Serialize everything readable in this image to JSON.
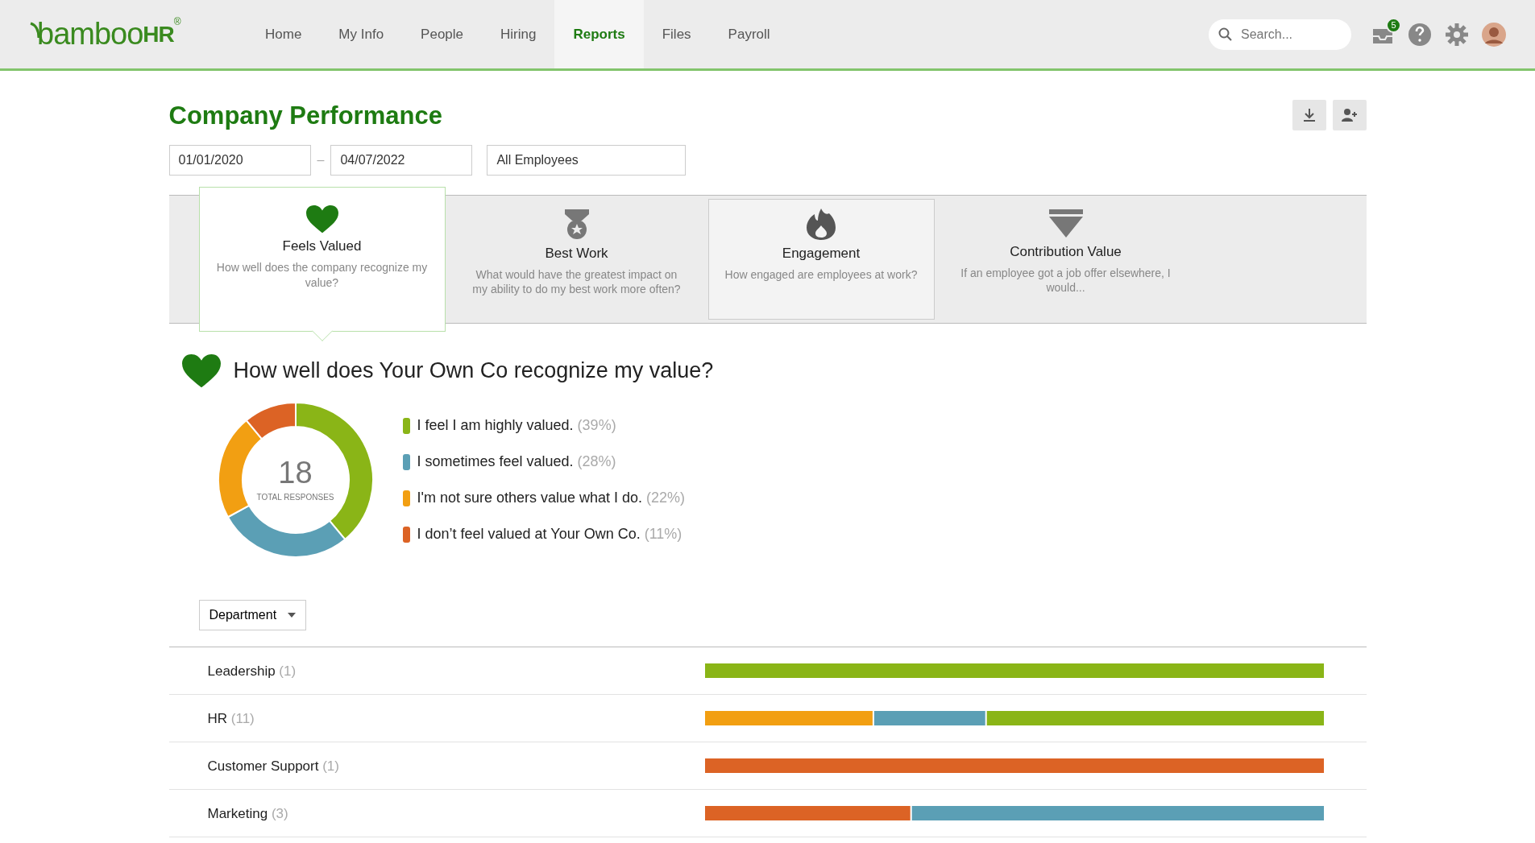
{
  "header": {
    "logo_text": "bamboo",
    "logo_suffix": "HR",
    "logo_mark": "®",
    "nav": [
      {
        "label": "Home",
        "selected": false
      },
      {
        "label": "My Info",
        "selected": false
      },
      {
        "label": "People",
        "selected": false
      },
      {
        "label": "Hiring",
        "selected": false
      },
      {
        "label": "Reports",
        "selected": true
      },
      {
        "label": "Files",
        "selected": false
      },
      {
        "label": "Payroll",
        "selected": false
      }
    ],
    "search": {
      "placeholder": "Search..."
    },
    "inbox_count": "5"
  },
  "page": {
    "title": "Company Performance",
    "start_date": "01/01/2020",
    "separator": "–",
    "end_date": "04/07/2022",
    "group": "All Employees"
  },
  "tabs": [
    {
      "kind": "heart",
      "title": "Feels Valued",
      "subtitle": "How well does the company recognize my value?",
      "selected": true,
      "highlighted": false
    },
    {
      "kind": "medal",
      "title": "Best Work",
      "subtitle": "What would have the greatest impact on my ability to do my best work more often?",
      "selected": false,
      "highlighted": false
    },
    {
      "kind": "flame",
      "title": "Engagement",
      "subtitle": "How engaged are employees at work?",
      "selected": false,
      "highlighted": true
    },
    {
      "kind": "diamond",
      "title": "Contribution Value",
      "subtitle": "If an employee got a job offer elsewhere, I would...",
      "selected": false,
      "highlighted": false
    }
  ],
  "question": "How well does Your Own Co recognize my value?",
  "donut": {
    "center_value": "18",
    "center_label": "TOTAL RESPONSES",
    "chart_data": {
      "type": "donut",
      "categories": [
        "I feel I am highly valued.",
        "I sometimes feel valued.",
        "I'm not sure others value what I do.",
        "I don’t feel valued at Your Own Co."
      ],
      "values": [
        39,
        28,
        22,
        11
      ]
    },
    "legend": [
      {
        "percent": "(39%)",
        "color": "#8ab517"
      },
      {
        "percent": "(28%)",
        "color": "#5b9fb5"
      },
      {
        "percent": "(22%)",
        "color": "#f29f12"
      },
      {
        "percent": "(11%)",
        "color": "#dc6325"
      }
    ]
  },
  "breakdown": {
    "dropdown": "Department",
    "rows": [
      {
        "name": "Leadership",
        "count": "(1)"
      },
      {
        "name": "HR",
        "count": "(11)"
      },
      {
        "name": "Customer Support",
        "count": "(1)"
      },
      {
        "name": "Marketing",
        "count": "(3)"
      }
    ]
  }
}
